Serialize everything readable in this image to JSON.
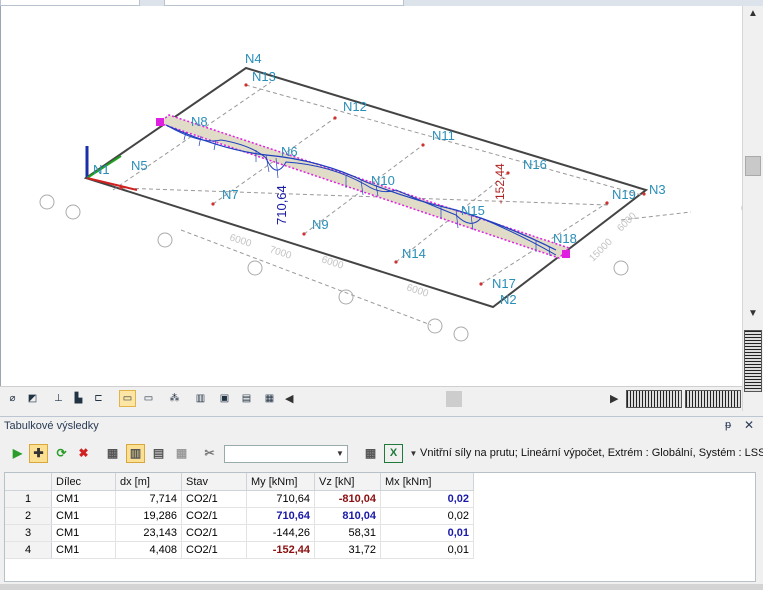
{
  "model_view": {
    "nodes": [
      "N4",
      "N13",
      "N12",
      "N11",
      "N16",
      "N19",
      "N3",
      "N8",
      "N6",
      "N10",
      "N15",
      "N18",
      "N1",
      "N5",
      "N7",
      "N9",
      "N14",
      "N17",
      "N2"
    ],
    "dimension_labels": [
      "6000",
      "7000",
      "6000",
      "6000",
      "6000",
      "15000"
    ],
    "result_values": {
      "max_label": "710,64",
      "min_label": "-152,44"
    }
  },
  "panel": {
    "title": "Tabulkové výsledky",
    "pin_label": "ᵽ",
    "close_label": "✕",
    "combo_value": "",
    "description": "Vnitřní síly na prutu; Lineární výpočet, Extrém : Globální, Systém : LSS,"
  },
  "table": {
    "columns": [
      "",
      "Dílec",
      "dx [m]",
      "Stav",
      "My [kNm]",
      "Vz [kN]",
      "Mx [kNm]"
    ],
    "rows": [
      {
        "n": "1",
        "member": "CM1",
        "dx": "7,714",
        "case": "CO2/1",
        "my": "710,64",
        "vz": "-810,04",
        "mx": "0,02"
      },
      {
        "n": "2",
        "member": "CM1",
        "dx": "19,286",
        "case": "CO2/1",
        "my": "710,64",
        "vz": "810,04",
        "mx": "0,02"
      },
      {
        "n": "3",
        "member": "CM1",
        "dx": "23,143",
        "case": "CO2/1",
        "my": "-144,26",
        "vz": "58,31",
        "mx": "0,01"
      },
      {
        "n": "4",
        "member": "CM1",
        "dx": "4,408",
        "case": "CO2/1",
        "my": "-152,44",
        "vz": "31,72",
        "mx": "0,01"
      }
    ]
  },
  "colors": {
    "accent": "#f0c040",
    "max_value": "#1a1aa8",
    "min_value": "#8b1010",
    "diagram_fill": "#e0dcc8",
    "node_label": "#2a8fb8",
    "load_line": "#e020e0"
  }
}
